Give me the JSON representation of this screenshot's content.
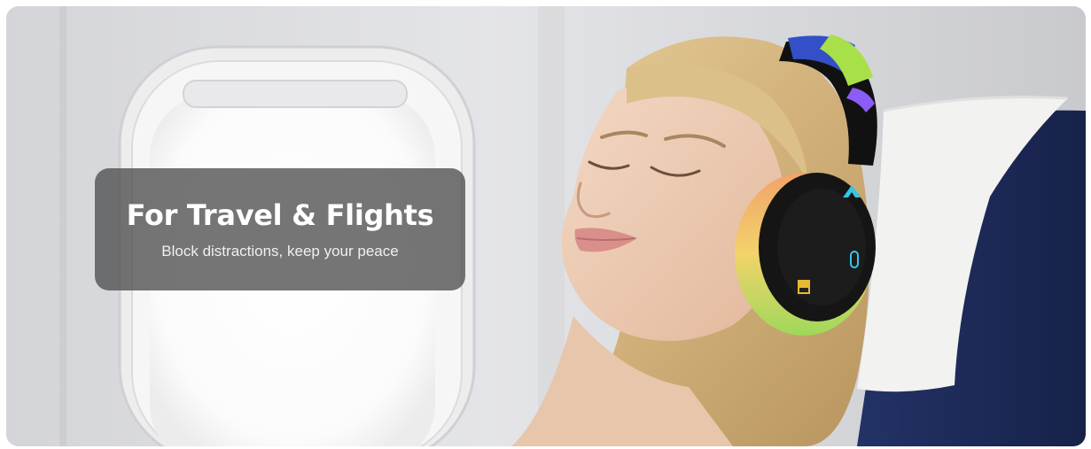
{
  "banner": {
    "title": "For Travel & Flights",
    "subtitle": "Block distractions, keep your peace"
  },
  "icons": [
    "headphone-brand-logo-icon",
    "hi-res-audio-badge-icon",
    "power-button-icon"
  ],
  "colors": {
    "caption_bg": "#4e4e50",
    "caption_text": "#ffffff",
    "seat_blue": "#1f2d5c",
    "headphone_body": "#111111",
    "accent_cyan": "#33c7e6",
    "headband_green": "#a8e04a",
    "headband_blue": "#3350c8"
  }
}
